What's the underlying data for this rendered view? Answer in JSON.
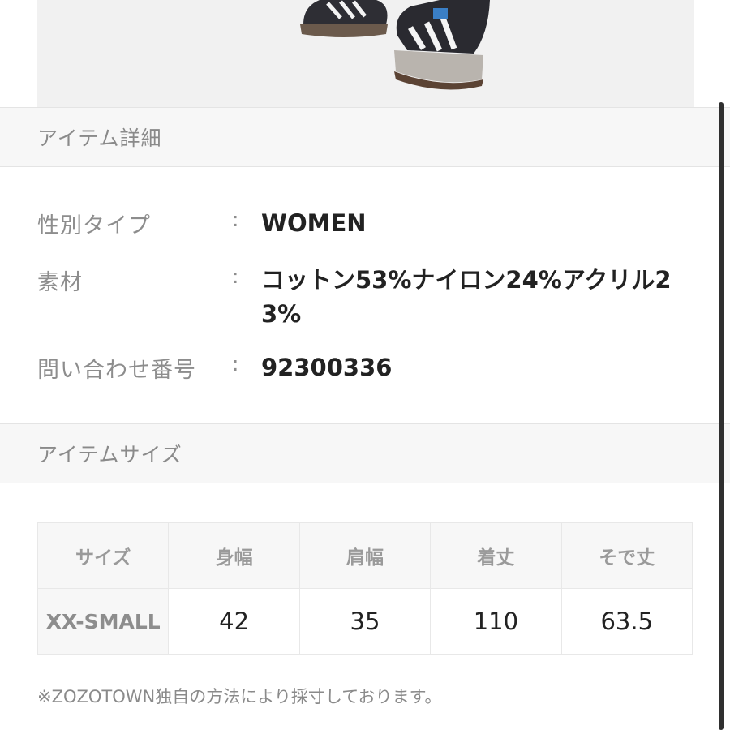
{
  "photo": {
    "icon": "product-photo-sneakers"
  },
  "item_details": {
    "title": "アイテム詳細",
    "rows": [
      {
        "label": "性別タイプ",
        "separator": ":",
        "value": "WOMEN"
      },
      {
        "label": "素材",
        "separator": ":",
        "value": "コットン53%ナイロン24%アクリル23%"
      },
      {
        "label": "問い合わせ番号",
        "separator": ":",
        "value": "92300336"
      }
    ]
  },
  "item_size": {
    "title": "アイテムサイズ",
    "headers": [
      "サイズ",
      "身幅",
      "肩幅",
      "着丈",
      "そで丈"
    ],
    "rows": [
      {
        "size": "XX-SMALL",
        "values": [
          "42",
          "35",
          "110",
          "63.5"
        ]
      }
    ],
    "note": "※ZOZOTOWN独自の方法により採寸しております。"
  },
  "colors": {
    "header_bg": "#f7f7f7",
    "label_text": "#8d8d8d",
    "value_text": "#222222",
    "border": "#e4e4e4"
  }
}
